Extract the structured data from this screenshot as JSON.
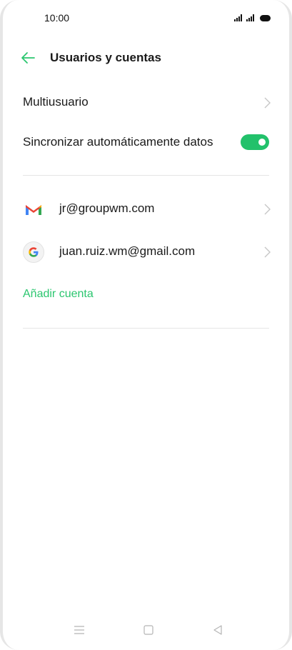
{
  "status_bar": {
    "time": "10:00"
  },
  "header": {
    "title": "Usuarios y cuentas"
  },
  "settings": {
    "multiuser_label": "Multiusuario",
    "auto_sync_label": "Sincronizar automáticamente datos",
    "auto_sync_on": true
  },
  "accounts": [
    {
      "email": "jr@groupwm.com",
      "icon": "gmail-icon"
    },
    {
      "email": "juan.ruiz.wm@gmail.com",
      "icon": "google-icon"
    }
  ],
  "add_account_label": "Añadir cuenta",
  "colors": {
    "accent": "#2bc66f",
    "toggle_on": "#22c16b",
    "chevron": "#c6c6c6",
    "divider": "#e5e5e5",
    "nav_icon": "#b5b5b5"
  },
  "nav_bar": {
    "icons": [
      "menu-icon",
      "home-icon",
      "back-triangle-icon"
    ]
  }
}
